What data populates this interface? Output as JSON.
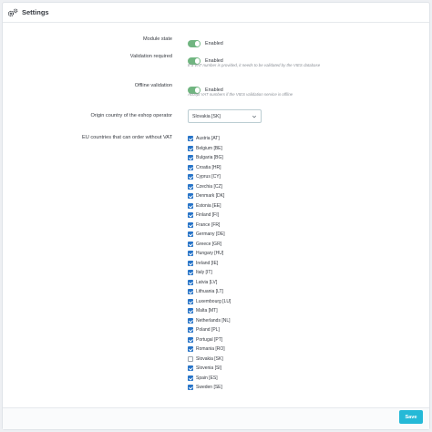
{
  "panel": {
    "title": "Settings",
    "icon": "gears-icon"
  },
  "module_state": {
    "label": "Module state",
    "value": "Enabled"
  },
  "validation_required": {
    "label": "Validation required",
    "value": "Enabled",
    "help": "If a VAT number is provided, it needs to be validated by the VIES database"
  },
  "offline_validation": {
    "label": "Offline validation",
    "value": "Enabled",
    "help": "Accept VAT numbers if the VIES validation service is offline"
  },
  "origin_country": {
    "label": "Origin country of the eshop operator",
    "value": "Slovakia [SK]"
  },
  "eu_countries": {
    "label": "EU countries that can order without VAT",
    "items": [
      {
        "name": "Austria [AT]",
        "checked": true
      },
      {
        "name": "Belgium [BE]",
        "checked": true
      },
      {
        "name": "Bulgaria [BG]",
        "checked": true
      },
      {
        "name": "Croatia [HR]",
        "checked": true
      },
      {
        "name": "Cyprus [CY]",
        "checked": true
      },
      {
        "name": "Czechia [CZ]",
        "checked": true
      },
      {
        "name": "Denmark [DK]",
        "checked": true
      },
      {
        "name": "Estonia [EE]",
        "checked": true
      },
      {
        "name": "Finland [FI]",
        "checked": true
      },
      {
        "name": "France [FR]",
        "checked": true
      },
      {
        "name": "Germany [DE]",
        "checked": true
      },
      {
        "name": "Greece [GR]",
        "checked": true
      },
      {
        "name": "Hungary [HU]",
        "checked": true
      },
      {
        "name": "Ireland [IE]",
        "checked": true
      },
      {
        "name": "Italy [IT]",
        "checked": true
      },
      {
        "name": "Latvia [LV]",
        "checked": true
      },
      {
        "name": "Lithuania [LT]",
        "checked": true
      },
      {
        "name": "Luxembourg [LU]",
        "checked": true
      },
      {
        "name": "Malta [MT]",
        "checked": true
      },
      {
        "name": "Netherlands [NL]",
        "checked": true
      },
      {
        "name": "Poland [PL]",
        "checked": true
      },
      {
        "name": "Portugal [PT]",
        "checked": true
      },
      {
        "name": "Romania [RO]",
        "checked": true
      },
      {
        "name": "Slovakia [SK]",
        "checked": false
      },
      {
        "name": "Slovenia [SI]",
        "checked": true
      },
      {
        "name": "Spain [ES]",
        "checked": true
      },
      {
        "name": "Sweden [SE]",
        "checked": true
      }
    ]
  },
  "footer": {
    "save_label": "Save"
  },
  "colors": {
    "toggle_on": "#70b580",
    "checkbox": "#2774c8",
    "save_button": "#25b9d7"
  }
}
